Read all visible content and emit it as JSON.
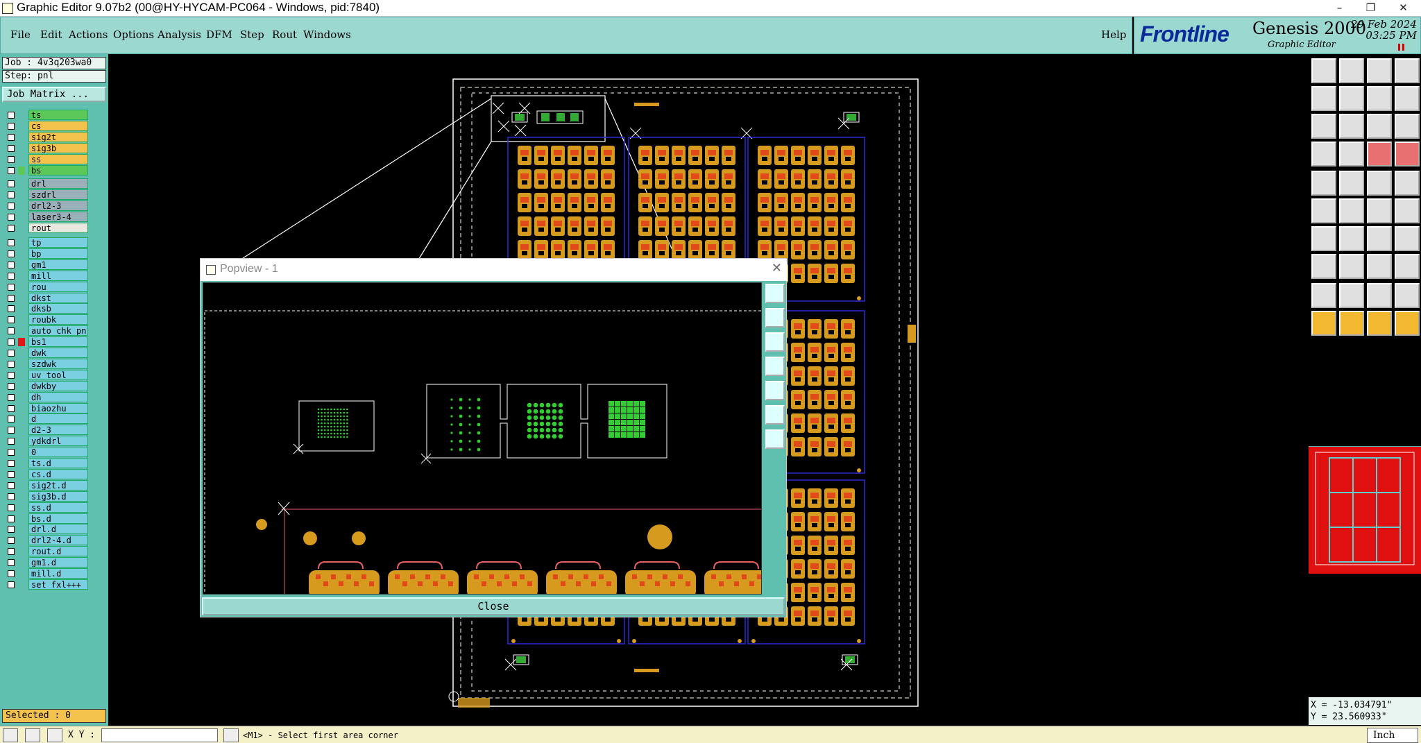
{
  "window": {
    "title": "Graphic Editor 9.07b2 (00@HY-HYCAM-PC064 - Windows, pid:7840)",
    "minimize": "–",
    "maximize": "❐",
    "close": "✕"
  },
  "menu": [
    "File",
    "Edit",
    "Actions",
    "Options",
    "Analysis",
    "DFM",
    "Step",
    "Rout",
    "Windows"
  ],
  "help": "Help",
  "brand": {
    "logo": "Frontline",
    "product": "Genesis 2000",
    "module": "Graphic Editor",
    "date": "29 Feb 2024",
    "time": "03:25 PM"
  },
  "job": {
    "job": "Job : 4v3q203wa0",
    "step": "Step: pnl",
    "matrix_button": "Job Matrix ..."
  },
  "layers": [
    {
      "name": "ts",
      "color": "#5cc85a",
      "group": 1
    },
    {
      "name": "cs",
      "color": "#f2c24c",
      "group": 1
    },
    {
      "name": "sig2t",
      "color": "#f2c24c",
      "group": 1
    },
    {
      "name": "sig3b",
      "color": "#f2c24c",
      "group": 1
    },
    {
      "name": "ss",
      "color": "#f2c24c",
      "group": 1
    },
    {
      "name": "bs",
      "color": "#5cc85a",
      "group": 1,
      "swatch": "#5cc85a"
    },
    {
      "name": "drl",
      "color": "#9ab0b8",
      "group": 2
    },
    {
      "name": "szdrl",
      "color": "#9ab0b8",
      "group": 2
    },
    {
      "name": "drl2-3",
      "color": "#9ab0b8",
      "group": 2
    },
    {
      "name": "laser3-4",
      "color": "#9ab0b8",
      "group": 2
    },
    {
      "name": "rout",
      "color": "#e8e8e0",
      "group": 2
    },
    {
      "name": "tp",
      "color": "#7ad0e0",
      "group": 3
    },
    {
      "name": "bp",
      "color": "#7ad0e0",
      "group": 3
    },
    {
      "name": "gm1",
      "color": "#7ad0e0",
      "group": 3
    },
    {
      "name": "mill",
      "color": "#7ad0e0",
      "group": 3
    },
    {
      "name": "rou",
      "color": "#7ad0e0",
      "group": 3
    },
    {
      "name": "dkst",
      "color": "#7ad0e0",
      "group": 3
    },
    {
      "name": "dksb",
      "color": "#7ad0e0",
      "group": 3
    },
    {
      "name": "roubk",
      "color": "#7ad0e0",
      "group": 3
    },
    {
      "name": "auto_chk_pn.",
      "color": "#7ad0e0",
      "group": 3
    },
    {
      "name": "bs1",
      "color": "#7ad0e0",
      "group": 3,
      "swatch": "#e01818",
      "mark": true
    },
    {
      "name": "dwk",
      "color": "#7ad0e0",
      "group": 3
    },
    {
      "name": "szdwk",
      "color": "#7ad0e0",
      "group": 3
    },
    {
      "name": "uv_tool",
      "color": "#7ad0e0",
      "group": 3
    },
    {
      "name": "dwkby",
      "color": "#7ad0e0",
      "group": 3
    },
    {
      "name": "dh",
      "color": "#7ad0e0",
      "group": 3
    },
    {
      "name": "biaozhu",
      "color": "#7ad0e0",
      "group": 3
    },
    {
      "name": "d",
      "color": "#7ad0e0",
      "group": 3
    },
    {
      "name": "d2-3",
      "color": "#7ad0e0",
      "group": 3
    },
    {
      "name": "ydkdrl",
      "color": "#7ad0e0",
      "group": 3
    },
    {
      "name": "0",
      "color": "#7ad0e0",
      "group": 3
    },
    {
      "name": "ts.d",
      "color": "#7ad0e0",
      "group": 3
    },
    {
      "name": "cs.d",
      "color": "#7ad0e0",
      "group": 3
    },
    {
      "name": "sig2t.d",
      "color": "#7ad0e0",
      "group": 3
    },
    {
      "name": "sig3b.d",
      "color": "#7ad0e0",
      "group": 3
    },
    {
      "name": "ss.d",
      "color": "#7ad0e0",
      "group": 3
    },
    {
      "name": "bs.d",
      "color": "#7ad0e0",
      "group": 3
    },
    {
      "name": "drl.d",
      "color": "#7ad0e0",
      "group": 3
    },
    {
      "name": "drl2-4.d",
      "color": "#7ad0e0",
      "group": 3
    },
    {
      "name": "rout.d",
      "color": "#7ad0e0",
      "group": 3
    },
    {
      "name": "gm1.d",
      "color": "#7ad0e0",
      "group": 3
    },
    {
      "name": "mill.d",
      "color": "#7ad0e0",
      "group": 3
    },
    {
      "name": "set_fxl+++",
      "color": "#7ad0e0",
      "group": 3
    }
  ],
  "selected": "Selected : 0",
  "popview": {
    "title": "Popview - 1",
    "close_button": "Close"
  },
  "coords": {
    "x": "X = -13.034791\"",
    "y": "Y = 23.560933\""
  },
  "status": {
    "xy_label": "X Y :",
    "xy_value": "",
    "prompt": "<M1> - Select first area corner",
    "unit": "Inch"
  },
  "colors": {
    "panel": "#5fc0b0",
    "menubar": "#9ad8d0",
    "copper": "#d69a1e",
    "outline": "#ffffff",
    "board": "#2a2ad8"
  }
}
